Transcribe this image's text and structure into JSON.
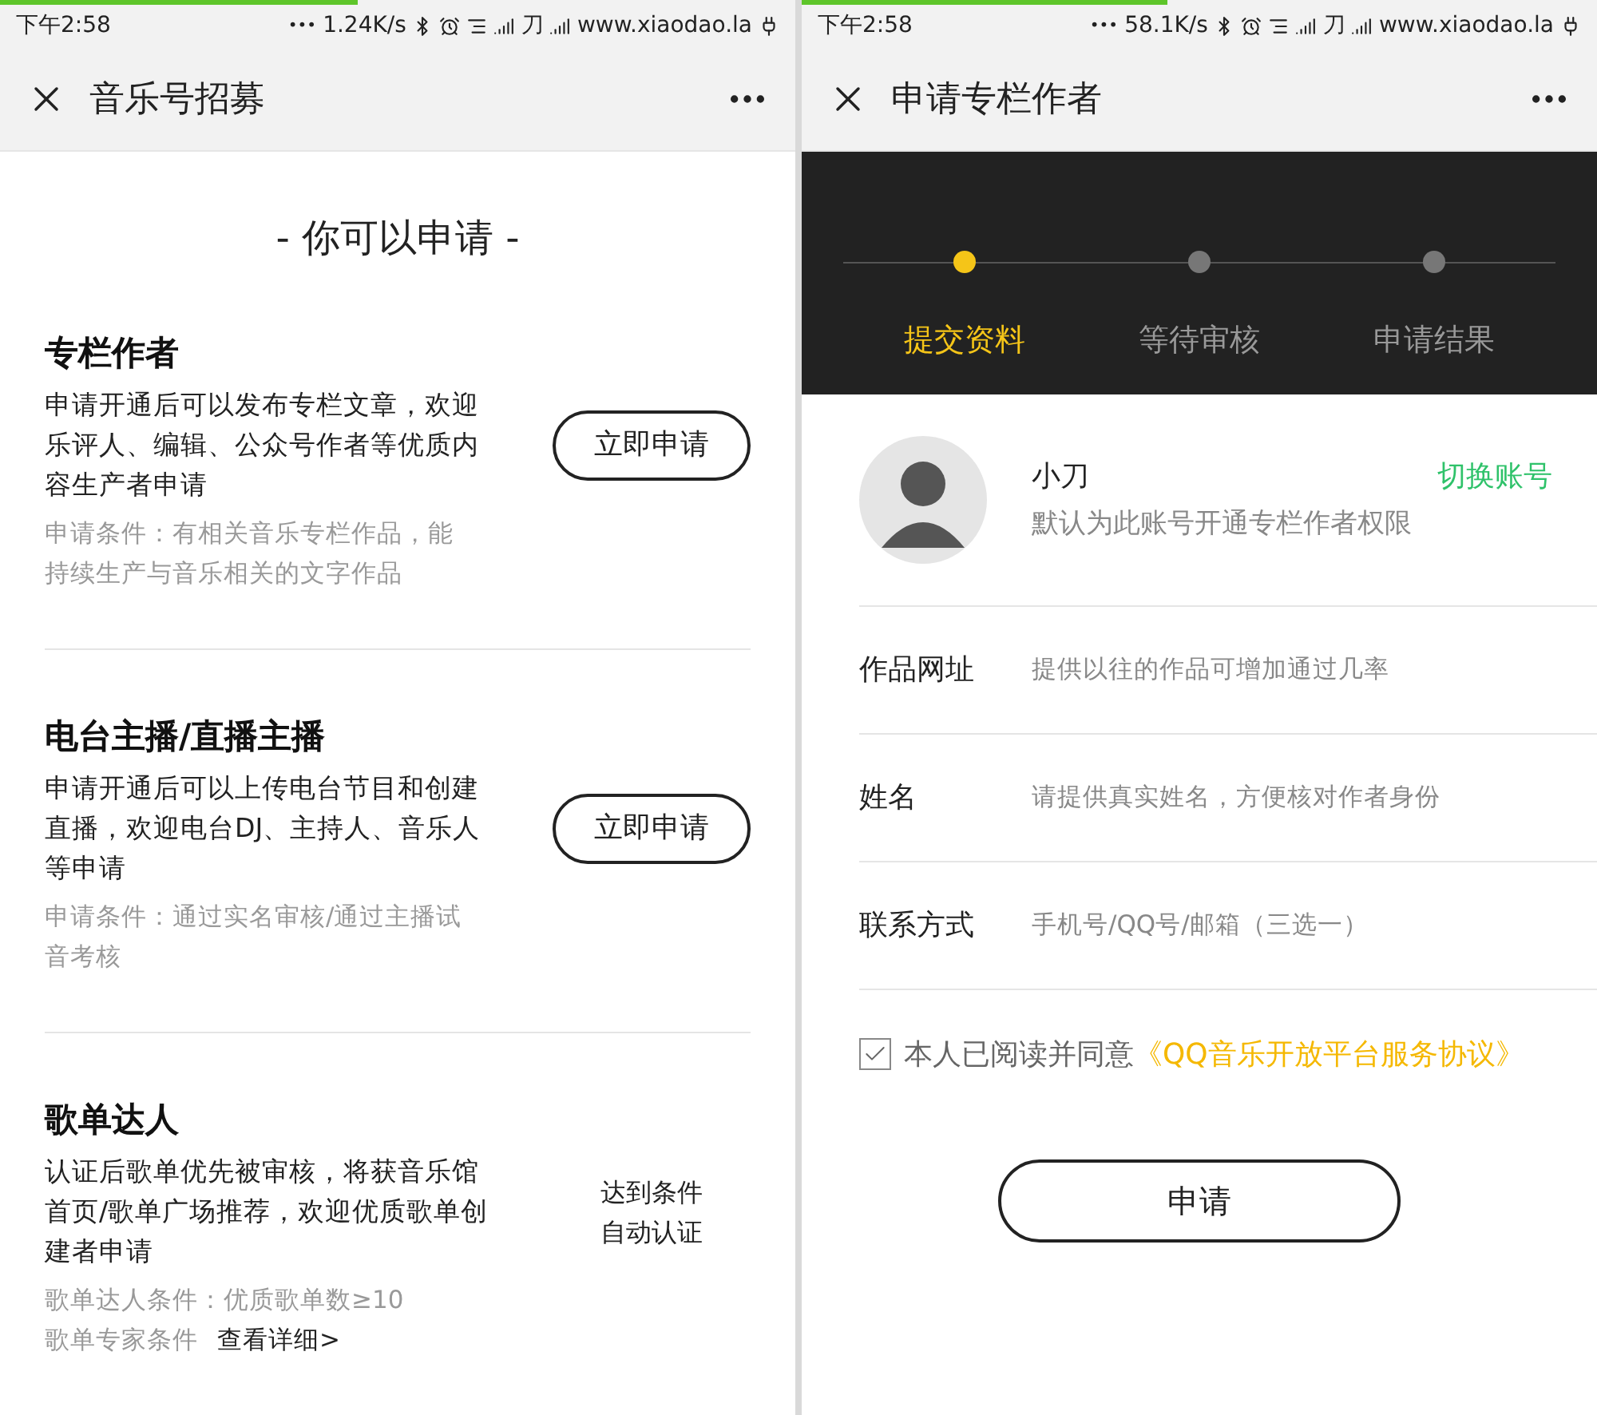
{
  "screens": [
    {
      "status_bar": {
        "loading": {
          "level": 0.45
        },
        "time": "下午2:58",
        "more": "•••",
        "speed": "1.24K/s",
        "carrier": "刀",
        "operator": "www.xiaodao.la"
      },
      "header": {
        "title": "音乐号招募"
      },
      "heading": "- 你可以申请 -",
      "sections": [
        {
          "title": "专栏作者",
          "description": "申请开通后可以发布专栏文章，欢迎乐评人、编辑、公众号作者等优质内容生产者申请",
          "conditions": [
            {
              "text": "申请条件：有相关音乐专栏作品，能持续生产与音乐相关的文字作品"
            }
          ],
          "action": {
            "kind": "button",
            "lines": [
              "立即申请"
            ]
          }
        },
        {
          "title": "电台主播/直播主播",
          "description": "申请开通后可以上传电台节目和创建直播，欢迎电台DJ、主持人、音乐人等申请",
          "conditions": [
            {
              "text": "申请条件：通过实名审核/通过主播试音考核"
            }
          ],
          "action": {
            "kind": "button",
            "lines": [
              "立即申请"
            ]
          }
        },
        {
          "title": "歌单达人",
          "description": "认证后歌单优先被审核，将获音乐馆首页/歌单广场推荐，欢迎优质歌单创建者申请",
          "conditions": [
            {
              "text": "歌单达人条件：优质歌单数≥10"
            },
            {
              "text": "歌单专家条件",
              "link": "查看详细>"
            }
          ],
          "action": {
            "kind": "note",
            "lines": [
              "达到条件",
              "自动认证"
            ]
          }
        }
      ]
    },
    {
      "status_bar": {
        "loading": {
          "level": 0.46
        },
        "time": "下午2:58",
        "more": "•••",
        "speed": "58.1K/s",
        "carrier": "刀",
        "operator": "www.xiaodao.la"
      },
      "header": {
        "title": "申请专栏作者"
      },
      "steps": [
        {
          "label": "提交资料",
          "selected": true
        },
        {
          "label": "等待审核",
          "selected": false
        },
        {
          "label": "申请结果",
          "selected": false
        }
      ],
      "user": {
        "name": "小刀",
        "note": "默认为此账号开通专栏作者权限",
        "switch": "切换账号"
      },
      "fields": [
        {
          "label": "作品网址",
          "placeholder": "提供以往的作品可增加通过几率"
        },
        {
          "label": "姓名",
          "placeholder": "请提供真实姓名，方便核对作者身份"
        },
        {
          "label": "联系方式",
          "placeholder": "手机号/QQ号/邮箱（三选一）"
        }
      ],
      "agreement": {
        "checked": true,
        "text": "本人已阅读并同意",
        "link": "《QQ音乐开放平台服务协议》"
      },
      "submit": "申请"
    }
  ]
}
